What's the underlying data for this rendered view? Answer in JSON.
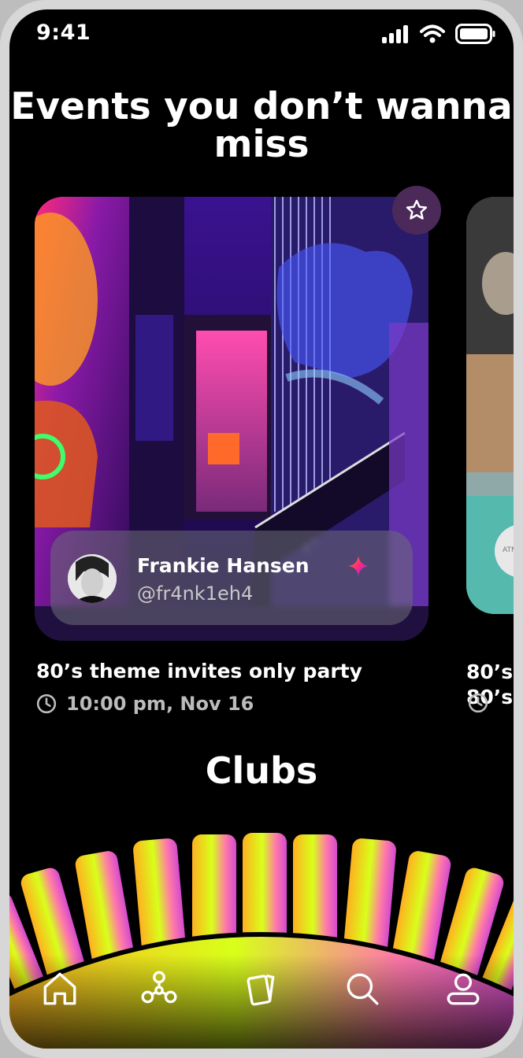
{
  "status_bar": {
    "time": "9:41"
  },
  "page_title": "Events you don’t wanna miss",
  "events": [
    {
      "host_name": "Frankie Hansen",
      "host_handle": "@fr4nk1eh4",
      "title": "80’s theme invites only party",
      "datetime": "10:00 pm, Nov 16",
      "favorite_icon": "star-icon"
    },
    {
      "title_line1": "80’s",
      "title_line2": "80’s",
      "badge_text": "ATM"
    }
  ],
  "section_title": "Clubs",
  "tab_bar": {
    "items": [
      {
        "icon": "home-icon"
      },
      {
        "icon": "clubs-icon"
      },
      {
        "icon": "cards-icon"
      },
      {
        "icon": "search-icon"
      },
      {
        "icon": "profile-icon"
      }
    ]
  },
  "colors": {
    "background": "#000000",
    "accent_pink": "#ff3fa8",
    "accent_purple": "#7b2cff",
    "accent_yellow": "#d8ff1a"
  }
}
